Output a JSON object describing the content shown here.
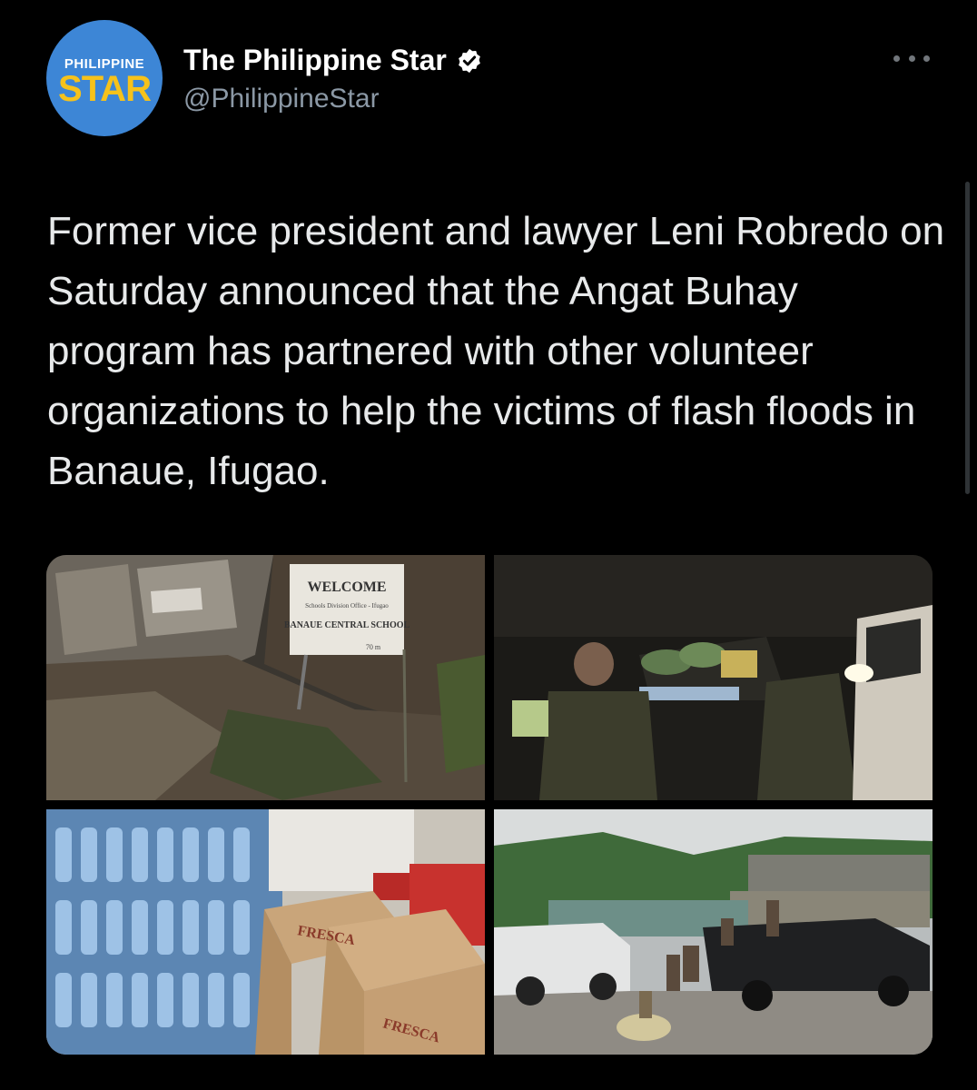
{
  "account": {
    "avatar_line1": "PHILIPPINE",
    "avatar_line2": "STAR",
    "display_name": "The Philippine Star",
    "handle": "@PhilippineStar",
    "verified_icon": "verified-badge-icon"
  },
  "tweet": {
    "text": "Former vice president and lawyer Leni Robredo on Saturday announced that the Angat Buhay program has partnered with other volunteer organizations to help the victims of flash floods in Banaue, Ifugao."
  },
  "photo1": {
    "sign_line1": "WELCOME",
    "sign_line2": "Schools Division Office - Ifugao",
    "sign_line3": "BANAUE CENTRAL SCHOOL",
    "sign_line4": "70 m"
  },
  "photo3": {
    "box_label": "FRESCA"
  },
  "colors": {
    "background": "#000000",
    "text": "#e7e9ea",
    "muted": "#8b98a5",
    "avatar_bg": "#3d86d6",
    "avatar_star": "#f6c21b",
    "verified": "#ffffff"
  }
}
